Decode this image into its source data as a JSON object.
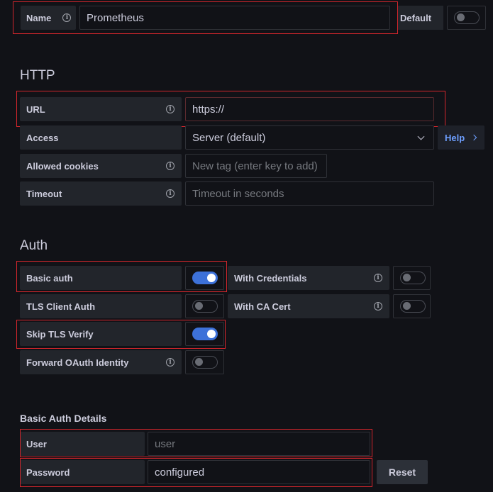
{
  "general": {
    "name_label": "Name",
    "name_value": "Prometheus",
    "default_label": "Default",
    "default_enabled": false
  },
  "http": {
    "title": "HTTP",
    "url_label": "URL",
    "url_value": "https://",
    "access_label": "Access",
    "access_value": "Server (default)",
    "help_label": "Help",
    "allowed_cookies_label": "Allowed cookies",
    "allowed_cookies_placeholder": "New tag (enter key to add)",
    "timeout_label": "Timeout",
    "timeout_placeholder": "Timeout in seconds"
  },
  "auth": {
    "title": "Auth",
    "basic_auth_label": "Basic auth",
    "basic_auth_enabled": true,
    "with_credentials_label": "With Credentials",
    "with_credentials_enabled": false,
    "tls_client_auth_label": "TLS Client Auth",
    "tls_client_auth_enabled": false,
    "with_ca_cert_label": "With CA Cert",
    "with_ca_cert_enabled": false,
    "skip_tls_verify_label": "Skip TLS Verify",
    "skip_tls_verify_enabled": true,
    "forward_oauth_label": "Forward OAuth Identity",
    "forward_oauth_enabled": false
  },
  "basic_auth_details": {
    "title": "Basic Auth Details",
    "user_label": "User",
    "user_placeholder": "user",
    "password_label": "Password",
    "password_value": "configured",
    "reset_label": "Reset"
  },
  "colors": {
    "background": "#111217",
    "label_bg": "#22252b",
    "toggle_on": "#3d71d9",
    "highlight": "#d2262c",
    "link": "#6e9fff"
  }
}
